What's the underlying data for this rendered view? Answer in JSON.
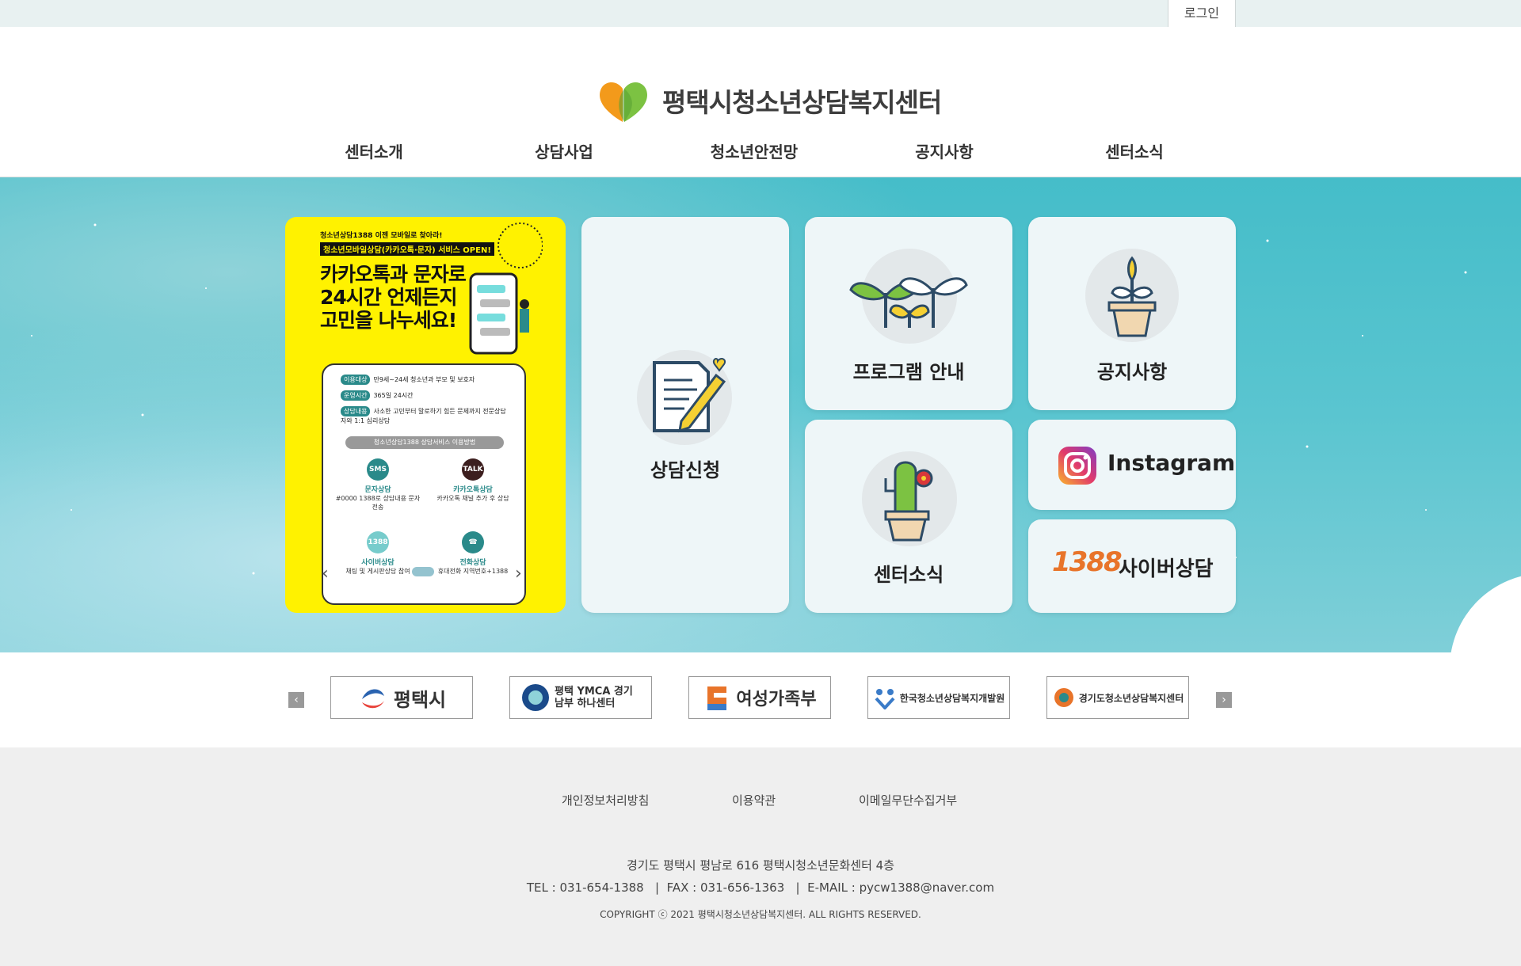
{
  "topbar": {
    "login_label": "로그인"
  },
  "header": {
    "site_title": "평택시청소년상담복지센터"
  },
  "nav": {
    "items": [
      "센터소개",
      "상담사업",
      "청소년안전망",
      "공지사항",
      "센터소식"
    ]
  },
  "poster": {
    "line1": "청소년상담1388 이젠 모바일로 찾아라!",
    "line2": "청소년모바일상담(카카오톡·문자) 서비스 OPEN!",
    "headline": [
      "카카오톡과 문자로",
      "24시간 언제든지",
      "고민을 나누세요!"
    ],
    "rows": [
      {
        "tag": "이용대상",
        "text": "만9세~24세 청소년과 부모 및 보호자"
      },
      {
        "tag": "운영시간",
        "text": "365일 24시간"
      },
      {
        "tag": "상담내용",
        "text": "사소한 고민부터 말로하기 힘든 문제까지 전문상담자와 1:1 심리상담"
      }
    ],
    "subtitle": "청소년상담1388 상담서비스 이용방법",
    "services": [
      {
        "icon": "SMS",
        "name": "문자상담",
        "desc": "#0000 1388로 상담내용 문자전송"
      },
      {
        "icon": "TALK",
        "name": "카카오톡상담",
        "desc": "카카오톡 채널 추가 후 상담"
      },
      {
        "icon": "1388",
        "name": "사이버상담",
        "desc": "채팅 및 게시판상담 참여"
      },
      {
        "icon": "☎",
        "name": "전화상담",
        "desc": "휴대전화 지역번호+1388"
      }
    ]
  },
  "cards": {
    "apply": "상담신청",
    "program": "프로그램 안내",
    "notice": "공지사항",
    "news": "센터소식",
    "instagram": "Instagram",
    "cyber": "사이버상담",
    "cyber_logo": "1388"
  },
  "partners": [
    {
      "name": "평택시"
    },
    {
      "name": "평택 YMCA 경기남부 하나센터"
    },
    {
      "name": "여성가족부"
    },
    {
      "name": "한국청소년상담복지개발원"
    },
    {
      "name": "경기도청소년상담복지센터"
    }
  ],
  "footer": {
    "links": [
      "개인정보처리방침",
      "이용약관",
      "이메일무단수집거부"
    ],
    "address": "경기도 평택시 평남로 616 평택시청소년문화센터 4층",
    "contact": "TEL : 031-654-1388   |  FAX : 031-656-1363   |  E-MAIL : pycw1388@naver.com",
    "copyright": "COPYRIGHT ⓒ 2021 평택시청소년상담복지센터. ALL RIGHTS RESERVED."
  },
  "colors": {
    "hero": "#45bdc9",
    "card": "#eef6f8",
    "poster": "#fff200",
    "footer": "#efefef"
  }
}
